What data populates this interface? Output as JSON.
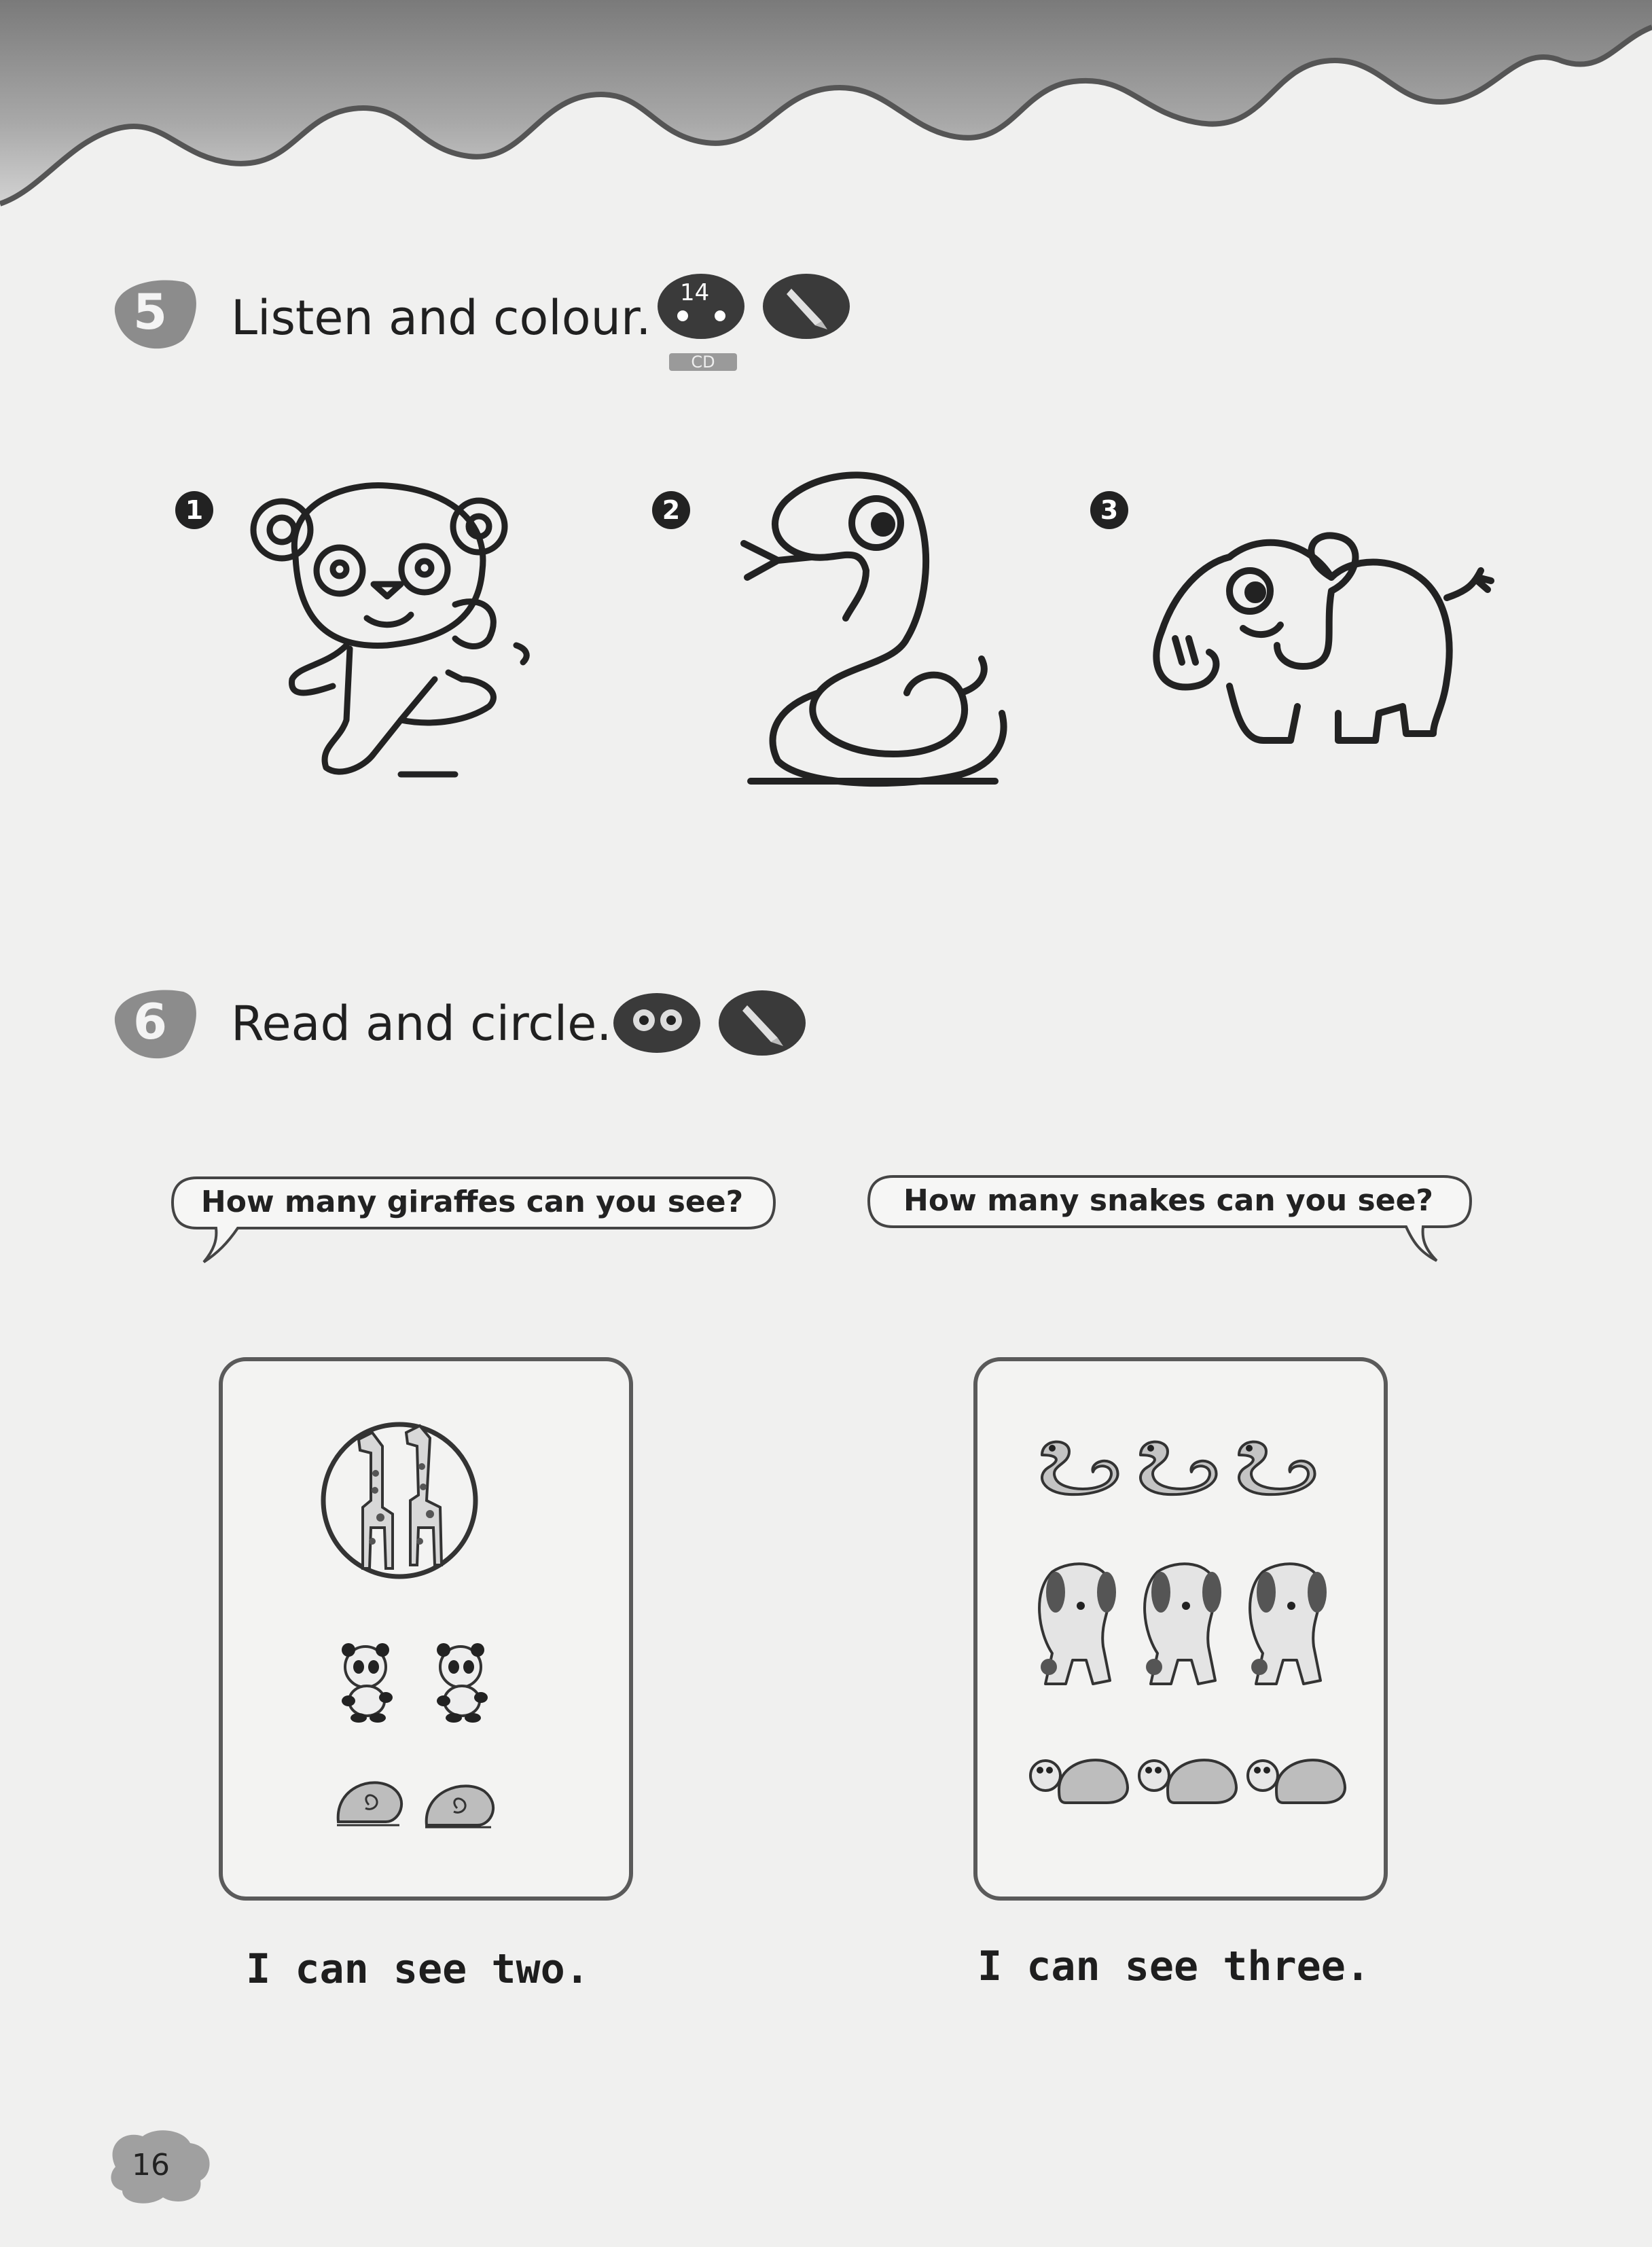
{
  "exercise5": {
    "number": "5",
    "title": "Listen and colour.",
    "cd_track": "14",
    "cd_label": "CD",
    "icons": [
      "cd-icon",
      "pencil-icon"
    ],
    "items": [
      {
        "number": "1",
        "picture": "panda-icon"
      },
      {
        "number": "2",
        "picture": "snake-icon"
      },
      {
        "number": "3",
        "picture": "elephant-icon"
      }
    ]
  },
  "exercise6": {
    "number": "6",
    "title": "Read and circle.",
    "icons": [
      "eyes-icon",
      "pencil-icon"
    ],
    "questions": [
      {
        "question": "How many giraffes can you see?",
        "answer": "I can see two.",
        "rows": [
          "giraffes",
          "pandas",
          "snails"
        ]
      },
      {
        "question": "How many snakes can you see?",
        "answer": "I can see three.",
        "rows": [
          "snakes",
          "dogs",
          "turtles"
        ]
      }
    ]
  },
  "page_number": "16"
}
